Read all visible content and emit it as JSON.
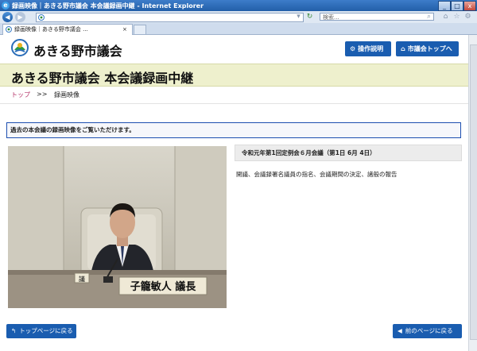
{
  "browser": {
    "window_title": "録画映像｜あきる野市議会 本会議録画中継 - Internet Explorer",
    "search_placeholder": "検索...",
    "tab_label": "録画映像｜あきる野市議会 ...",
    "tab_close": "×"
  },
  "header": {
    "site_name": "あきる野市議会",
    "buttons": [
      {
        "label": "操作説明",
        "icon": "gear-icon"
      },
      {
        "label": "市議会トップへ",
        "icon": "building-icon"
      }
    ]
  },
  "page_title": "あきる野市議会 本会議録画中継",
  "breadcrumb": {
    "top": "トップ",
    "separator": ">>",
    "current": "録画映像"
  },
  "notice": "過去の本会議の録画映像をご覧いただけます。",
  "video": {
    "nameplate": "子籠敏人 議長",
    "seal_text": "議"
  },
  "session": {
    "title": "令和元年第1回定例会６月会議（第1日 6月 4日）",
    "agenda": "開議、会議録署名議員の指名、会議期間の決定、諸般の報告"
  },
  "footer": {
    "top_button": "トップページに戻る",
    "back_button": "前のページに戻る"
  },
  "colors": {
    "accent": "#1a5db0",
    "band": "#eef0cd",
    "notice_border": "#1d4fb0",
    "breadcrumb_link": "#b5356a"
  }
}
